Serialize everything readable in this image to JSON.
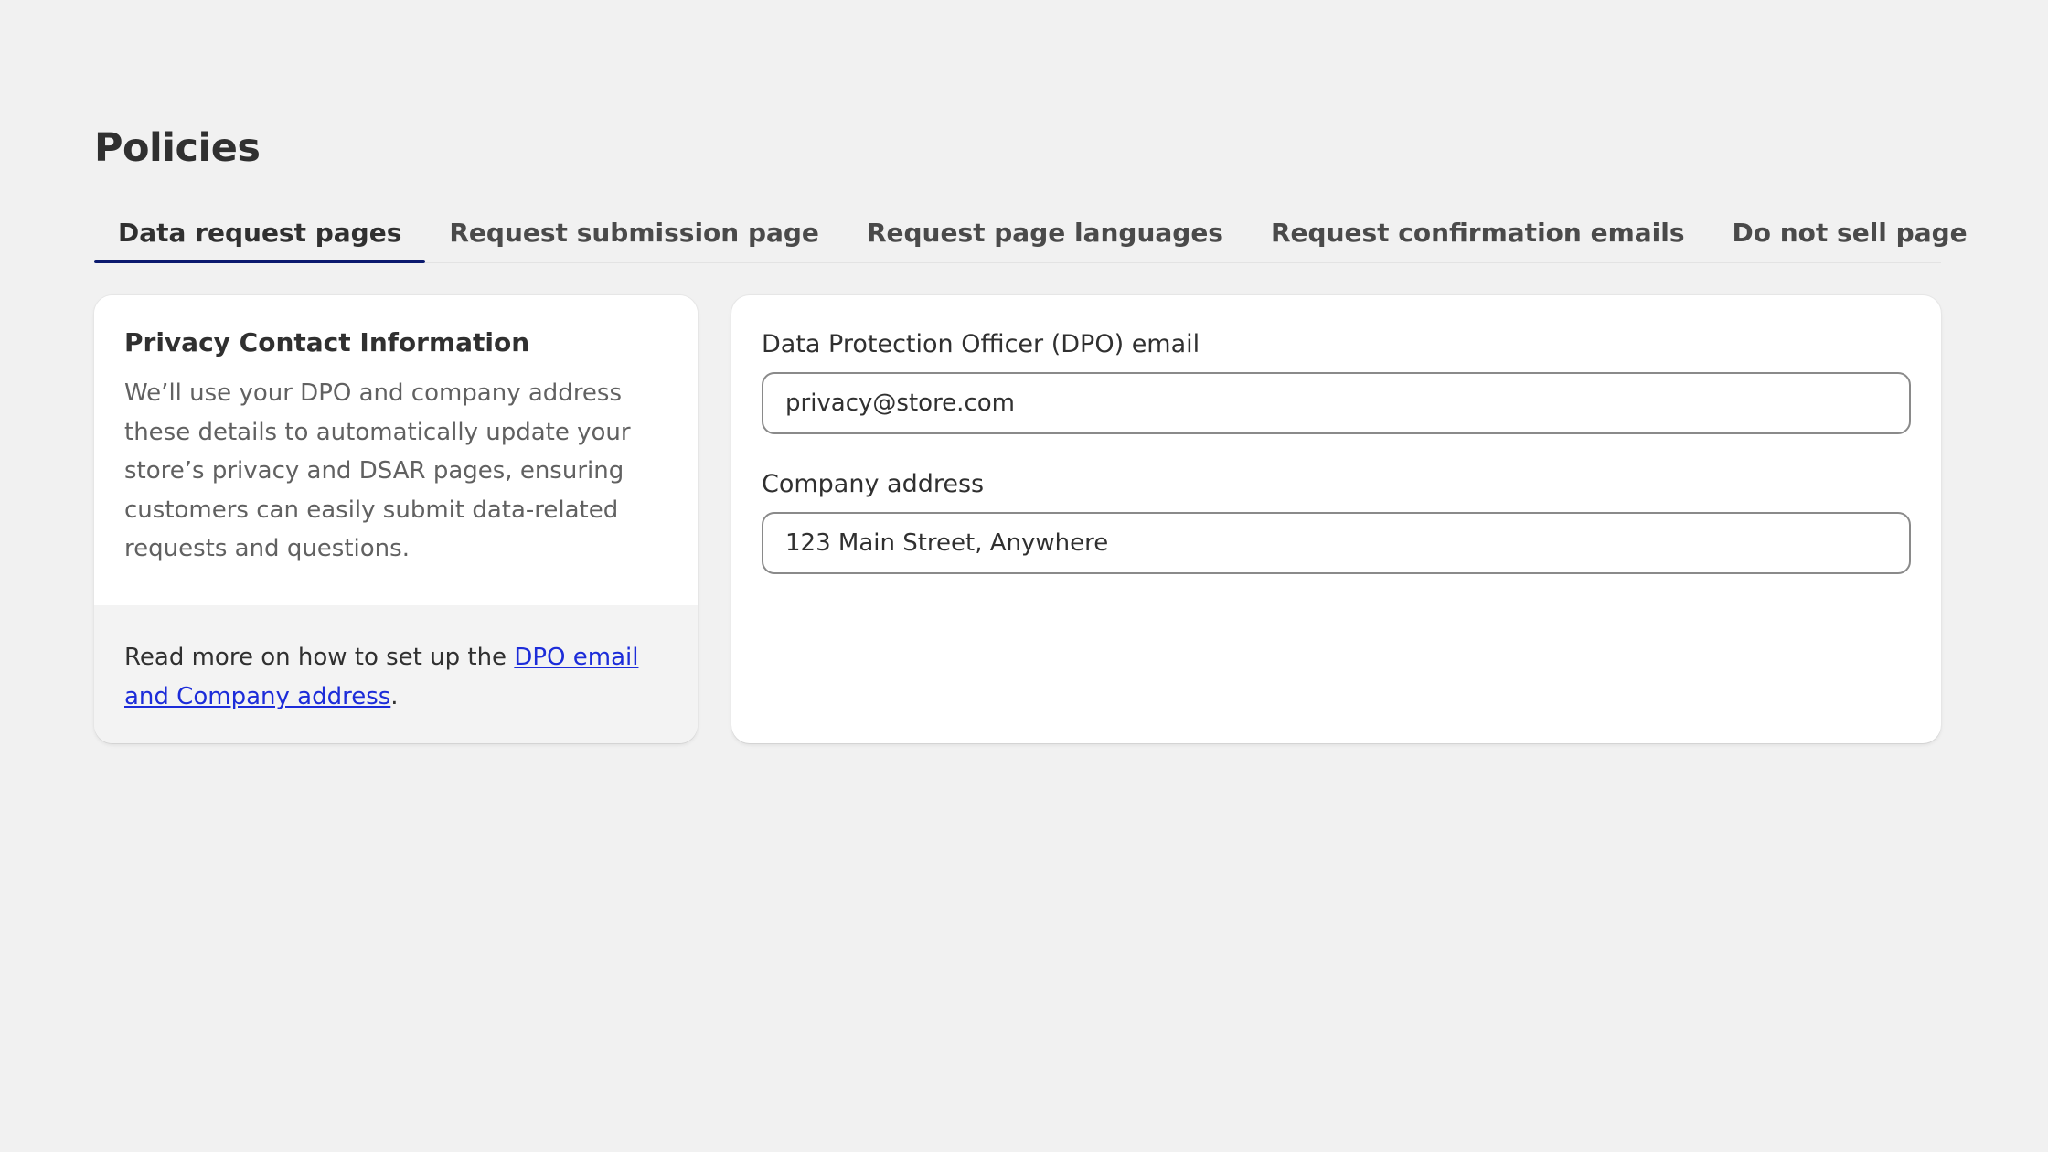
{
  "page": {
    "title": "Policies"
  },
  "tabs": [
    {
      "label": "Data request pages",
      "active": true
    },
    {
      "label": "Request submission page",
      "active": false
    },
    {
      "label": "Request page languages",
      "active": false
    },
    {
      "label": "Request confirmation emails",
      "active": false
    },
    {
      "label": "Do not sell page",
      "active": false
    }
  ],
  "info_card": {
    "heading": "Privacy Contact Information",
    "description": "We’ll use your DPO and company address these details to automatically update your store’s privacy and DSAR pages, ensuring customers can easily submit data-related requests and questions.",
    "read_more_prefix": "Read more on how to set up the ",
    "read_more_link": "DPO email and Company address",
    "read_more_suffix": "."
  },
  "form": {
    "dpo_label": "Data Protection Officer (DPO) email",
    "dpo_value": "privacy@store.com",
    "address_label": "Company address",
    "address_value": "123 Main Street, Anywhere"
  },
  "colors": {
    "background": "#f1f1f1",
    "active_tab_underline": "#0b1a6e",
    "link": "#1c2cd9"
  }
}
